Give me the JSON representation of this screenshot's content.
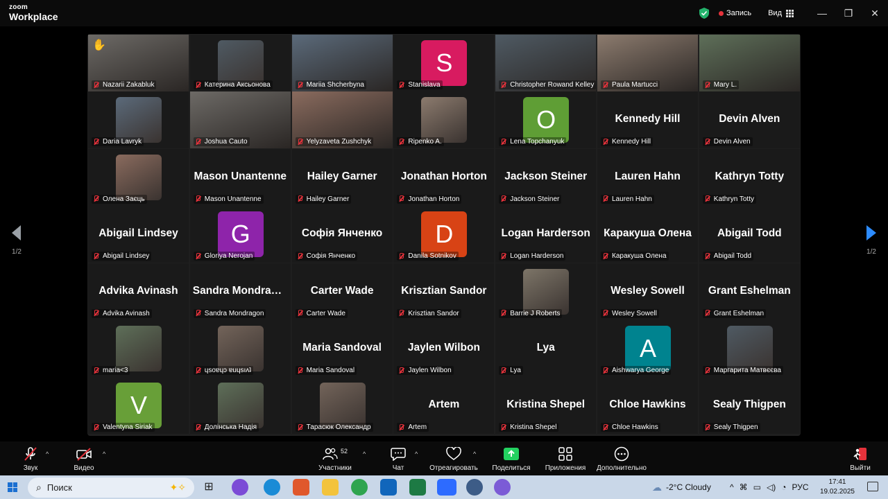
{
  "title_bar": {
    "logo_line1": "zoom",
    "logo_line2": "Workplace",
    "record_label": "Запись",
    "view_label": "Вид",
    "minimize": "—",
    "maximize": "❐",
    "close": "✕"
  },
  "gallery": {
    "page_left": "1/2",
    "page_right": "1/2",
    "tiles": [
      {
        "name": "Nazarii Zakabluk",
        "kind": "video",
        "active": true,
        "hand": "✋"
      },
      {
        "name": "Катерина Аксьонова",
        "kind": "photo"
      },
      {
        "name": "Mariia Shcherbyna",
        "kind": "video"
      },
      {
        "name": "Stanislava",
        "kind": "letter",
        "letter": "S",
        "color": "#d81b60"
      },
      {
        "name": "Christopher Rowand Kelley",
        "kind": "video"
      },
      {
        "name": "Paula Martucci",
        "kind": "video"
      },
      {
        "name": "Mary L.",
        "kind": "video"
      },
      {
        "name": "Daria Lavryk",
        "kind": "photo"
      },
      {
        "name": "Joshua Cauto",
        "kind": "video"
      },
      {
        "name": "Yelyzaveta Zushchyk",
        "kind": "video"
      },
      {
        "name": "Ripenko A.",
        "kind": "photo"
      },
      {
        "name": "Lena Topchanyuk",
        "kind": "letter",
        "letter": "O",
        "color": "#5f9e35"
      },
      {
        "name": "Kennedy Hill",
        "kind": "name",
        "big": "Kennedy Hill"
      },
      {
        "name": "Devin Alven",
        "kind": "name",
        "big": "Devin Alven"
      },
      {
        "name": "Олена Заєць",
        "kind": "photo"
      },
      {
        "name": "Mason Unantenne",
        "kind": "name",
        "big": "Mason  Unantenne"
      },
      {
        "name": "Hailey Garner",
        "kind": "name",
        "big": "Hailey Garner"
      },
      {
        "name": "Jonathan Horton",
        "kind": "name",
        "big": "Jonathan Horton"
      },
      {
        "name": "Jackson Steiner",
        "kind": "name",
        "big": "Jackson Steiner"
      },
      {
        "name": "Lauren Hahn",
        "kind": "name",
        "big": "Lauren Hahn"
      },
      {
        "name": "Kathryn Totty",
        "kind": "name",
        "big": "Kathryn Totty"
      },
      {
        "name": "Abigail Lindsey",
        "kind": "name",
        "big": "Abigail Lindsey"
      },
      {
        "name": "Gloriya Nerojan",
        "kind": "letter",
        "letter": "G",
        "color": "#8e24aa"
      },
      {
        "name": "Софія Янченко",
        "kind": "name",
        "big": "Софія Янченко"
      },
      {
        "name": "Danila Sotnikov",
        "kind": "letter",
        "letter": "D",
        "color": "#d84315"
      },
      {
        "name": "Logan Harderson",
        "kind": "name",
        "big": "Logan Harderson"
      },
      {
        "name": "Каракуша Олена",
        "kind": "name",
        "big": "Каракуша Олена"
      },
      {
        "name": "Abigail Todd",
        "kind": "name",
        "big": "Abigail Todd"
      },
      {
        "name": "Advika Avinash",
        "kind": "name",
        "big": "Advika Avinash"
      },
      {
        "name": "Sandra Mondragon",
        "kind": "name",
        "big": "Sandra Mondragon"
      },
      {
        "name": "Carter Wade",
        "kind": "name",
        "big": "Carter Wade"
      },
      {
        "name": "Krisztian Sandor",
        "kind": "name",
        "big": "Krisztian Sandor"
      },
      {
        "name": "Barrie J Roberts",
        "kind": "photo"
      },
      {
        "name": "Wesley Sowell",
        "kind": "name",
        "big": "Wesley Sowell"
      },
      {
        "name": "Grant Eshelman",
        "kind": "name",
        "big": "Grant Eshelman"
      },
      {
        "name": "maria<3",
        "kind": "photo"
      },
      {
        "name": "ɥsoɐɥɔ ɐuɥsıʌʇ",
        "kind": "photo"
      },
      {
        "name": "Maria Sandoval",
        "kind": "name",
        "big": "Maria Sandoval"
      },
      {
        "name": "Jaylen Wilbon",
        "kind": "name",
        "big": "Jaylen Wilbon"
      },
      {
        "name": "Lya",
        "kind": "name",
        "big": "Lya"
      },
      {
        "name": "Aishwarya George",
        "kind": "letter",
        "letter": "A",
        "color": "#00838f"
      },
      {
        "name": "Маргарита Матвєєва",
        "kind": "photo"
      },
      {
        "name": "Valentyna Siriak",
        "kind": "letter",
        "letter": "V",
        "color": "#689f38"
      },
      {
        "name": "Долінська Надія",
        "kind": "photo"
      },
      {
        "name": "Тарасюк Олександр",
        "kind": "photo"
      },
      {
        "name": "Artem",
        "kind": "name",
        "big": "Artem"
      },
      {
        "name": "Kristina Shepel",
        "kind": "name",
        "big": "Kristina Shepel"
      },
      {
        "name": "Chloe Hawkins",
        "kind": "name",
        "big": "Chloe Hawkins"
      },
      {
        "name": "Sealy Thigpen",
        "kind": "name",
        "big": "Sealy Thigpen"
      }
    ]
  },
  "toolbar": {
    "audio": "Звук",
    "video": "Видео",
    "participants": "Участники",
    "participants_count": "52",
    "chat": "Чат",
    "react": "Отреагировать",
    "share": "Поделиться",
    "apps": "Приложения",
    "more": "Дополнительно",
    "leave": "Выйти"
  },
  "taskbar": {
    "search_placeholder": "Поиск",
    "weather": "-2°C  Cloudy",
    "lang": "РУС",
    "time": "17:41",
    "date": "19.02.2025"
  }
}
